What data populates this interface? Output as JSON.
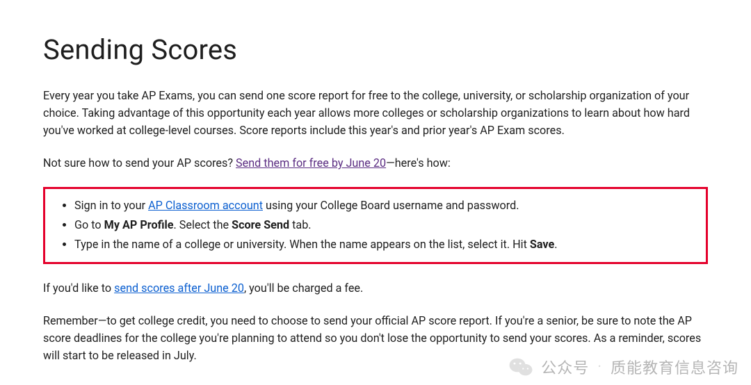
{
  "title": "Sending Scores",
  "intro": "Every year you take AP Exams, you can send one score report for free to the college, university, or scholarship organization of your choice. Taking advantage of this opportunity each year allows more colleges or scholarship organizations to learn about how hard you've worked at college-level courses. Score reports include this year's and prior year's AP Exam scores.",
  "not_sure_prefix": "Not sure how to send your AP scores? ",
  "not_sure_link": "Send them for free by June 20",
  "not_sure_suffix": "—here's how:",
  "steps": {
    "s1_prefix": "Sign in to your ",
    "s1_link": "AP Classroom account",
    "s1_suffix": " using your College Board username and password.",
    "s2_prefix": "Go to ",
    "s2_bold1": "My AP Profile",
    "s2_mid": ". Select the ",
    "s2_bold2": "Score Send",
    "s2_suffix": " tab.",
    "s3_prefix": "Type in the name of a college or university. When the name appears on the list, select it. Hit ",
    "s3_bold1": "Save",
    "s3_suffix": "."
  },
  "after_prefix": "If you'd like to ",
  "after_link": "send scores after June 20",
  "after_suffix": ", you'll be charged a fee.",
  "reminder": "Remember—to get college credit, you need to choose to send your official AP score report. If you're a senior, be sure to note the AP score deadlines for the college you're planning to attend so you don't lose the opportunity to send your scores. As a reminder, scores will start to be released in July.",
  "watermark": {
    "label1": "公众号",
    "dot": "·",
    "label2": "质能教育信息咨询"
  }
}
